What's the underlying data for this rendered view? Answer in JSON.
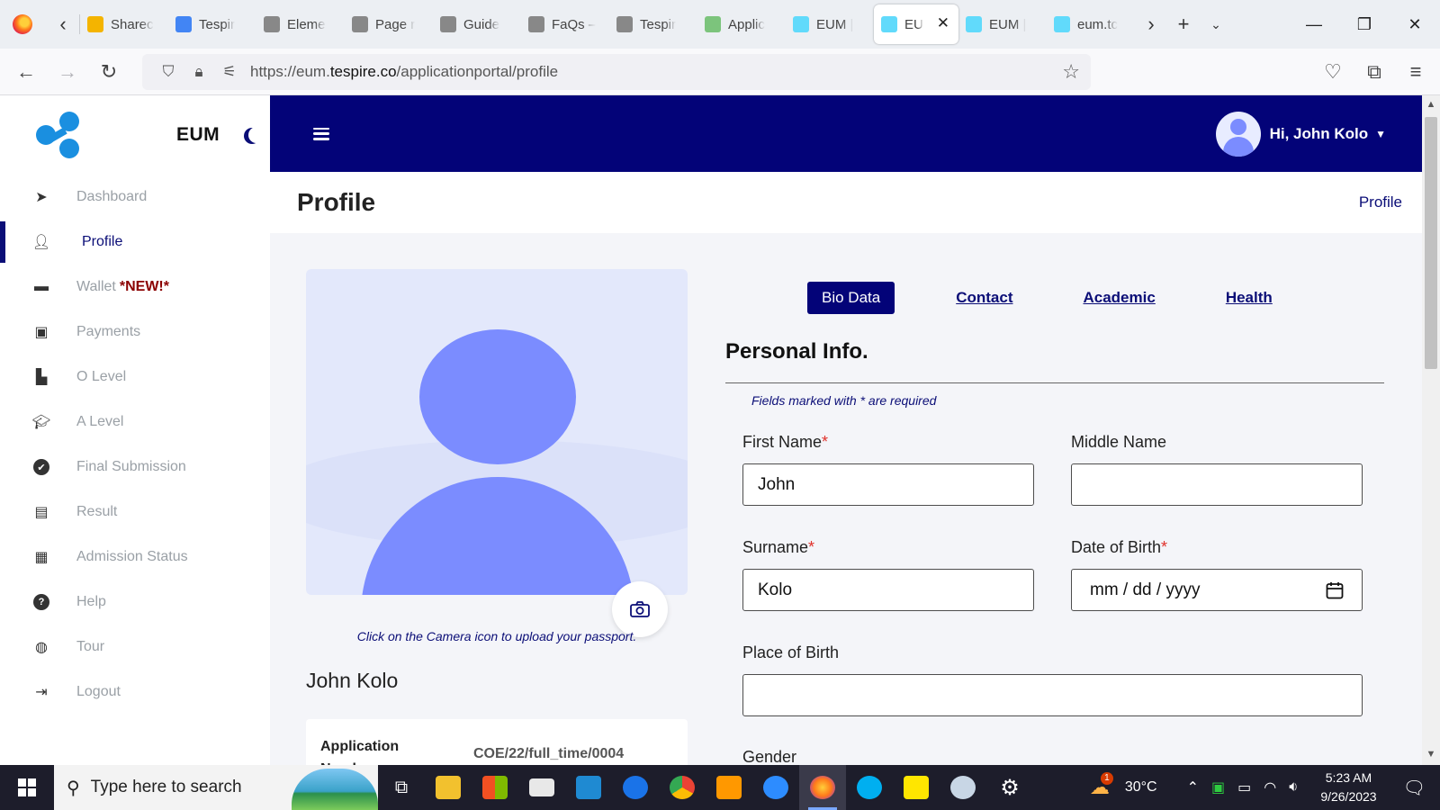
{
  "browser": {
    "tabs": [
      {
        "label": "Sharec",
        "icon": "google-drive-icon",
        "color": "#f4b400"
      },
      {
        "label": "Tespir",
        "icon": "google-docs-icon",
        "color": "#4285f4"
      },
      {
        "label": "Eleme",
        "icon": "tespire-icon",
        "color": "#888888"
      },
      {
        "label": "Page r",
        "icon": "tespire-icon",
        "color": "#888888"
      },
      {
        "label": "Guide",
        "icon": "tespire-icon",
        "color": "#888888"
      },
      {
        "label": "FaQs –",
        "icon": "tespire-icon",
        "color": "#888888"
      },
      {
        "label": "Tespir",
        "icon": "tespire-icon",
        "color": "#888888"
      },
      {
        "label": "Applic",
        "icon": "app-icon",
        "color": "#7cc47c"
      },
      {
        "label": "EUM |",
        "icon": "react-icon",
        "color": "#61dafb"
      },
      {
        "label": "EU",
        "icon": "react-icon",
        "color": "#61dafb",
        "active": true
      },
      {
        "label": "EUM |",
        "icon": "react-icon",
        "color": "#61dafb"
      },
      {
        "label": "eum.tc",
        "icon": "react-icon",
        "color": "#61dafb"
      }
    ],
    "url_prefix": "https://eum.",
    "url_domain": "tespire.co",
    "url_path": "/applicationportal/profile"
  },
  "sidebar": {
    "brand": "EUM",
    "items": [
      {
        "label": "Dashboard",
        "icon": "navigation-arrow-icon"
      },
      {
        "label": "Profile",
        "icon": "user-icon"
      },
      {
        "label": "Wallet",
        "badge": "*NEW!*",
        "icon": "wallet-icon"
      },
      {
        "label": "Payments",
        "icon": "money-icon"
      },
      {
        "label": "O Level",
        "icon": "scroll-icon"
      },
      {
        "label": "A Level",
        "icon": "graduation-cap-icon"
      },
      {
        "label": "Final Submission",
        "icon": "check-circle-icon"
      },
      {
        "label": "Result",
        "icon": "document-icon"
      },
      {
        "label": "Admission Status",
        "icon": "grid-icon"
      },
      {
        "label": "Help",
        "icon": "question-circle-icon"
      },
      {
        "label": "Tour",
        "icon": "globe-icon"
      },
      {
        "label": "Logout",
        "icon": "logout-icon"
      }
    ]
  },
  "header": {
    "greeting": "Hi, John Kolo"
  },
  "page": {
    "title": "Profile",
    "breadcrumb": "Profile"
  },
  "profile": {
    "camera_note": "Click on the Camera icon to upload your passport.",
    "full_name": "John Kolo",
    "application_label": "Application Number",
    "application_value": "COE/22/full_time/0004"
  },
  "tabs": [
    "Bio Data",
    "Contact",
    "Academic",
    "Health"
  ],
  "form": {
    "section_title": "Personal Info.",
    "required_note": "Fields marked with * are required",
    "first_name_label": "First Name",
    "first_name_value": "John",
    "middle_name_label": "Middle Name",
    "middle_name_value": "",
    "surname_label": "Surname",
    "surname_value": "Kolo",
    "dob_label": "Date of Birth",
    "dob_placeholder": "mm / dd / yyyy",
    "pob_label": "Place of Birth",
    "pob_value": "",
    "next_label": "Gender",
    "required_mark": "*"
  },
  "taskbar": {
    "search_placeholder": "Type here to search",
    "temperature": "30°C",
    "time": "5:23 AM",
    "date": "9/26/2023",
    "weather_badge": "1"
  },
  "colors": {
    "primary": "#030378",
    "accent": "#7b8cff",
    "required": "#e0312b",
    "badge": "#8b0000"
  }
}
